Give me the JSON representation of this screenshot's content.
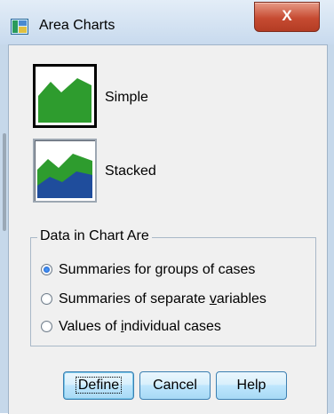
{
  "window": {
    "title": "Area Charts",
    "close_glyph": "X"
  },
  "charts": [
    {
      "label": "Simple",
      "icon": "simple-area-chart-icon"
    },
    {
      "label": "Stacked",
      "icon": "stacked-area-chart-icon"
    }
  ],
  "data_group": {
    "legend": "Data in Chart Are",
    "options": [
      {
        "pre": "Summaries for ",
        "key": "g",
        "post": "roups of cases",
        "selected": true
      },
      {
        "pre": "Summaries of separate ",
        "key": "v",
        "post": "ariables",
        "selected": false
      },
      {
        "pre": "Values of ",
        "key": "i",
        "post": "ndividual cases",
        "selected": false
      }
    ]
  },
  "buttons": {
    "define": "Define",
    "cancel": "Cancel",
    "help": "Help"
  },
  "colors": {
    "area_green": "#2e9c2e",
    "area_blue": "#1f4d9c",
    "accent": "#1a56c4"
  }
}
